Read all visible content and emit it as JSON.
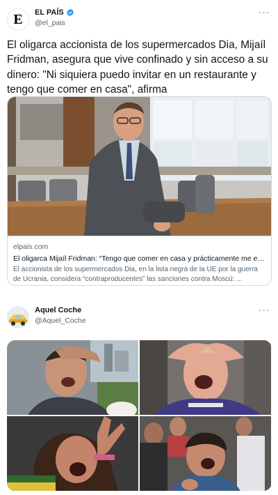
{
  "tweet1": {
    "author_name": "EL PAÍS",
    "author_handle": "@el_pais",
    "avatar_letter": "E",
    "more_label": "···",
    "text": "El oligarca accionista de los supermercados Dia, Mijaíl Fridman, asegura que vive confinado y sin acceso a su dinero: \"Ni siquiera puedo invitar en un restaurante y tengo que comer en casa\", afirma",
    "card": {
      "domain": "elpais.com",
      "title": "El oligarca Mijaíl Fridman: “Tengo que comer en casa y prácticamente me encu...",
      "description": "El accionista de los supermercados Dia, en la lista negra de la UE por la guerra de Ucrania, considera “contraproducentes” las sanciones contra Moscú: ..."
    }
  },
  "tweet2": {
    "author_name": "Aquel Coche",
    "author_handle": "@Aquel_Coche",
    "more_label": "···"
  },
  "colors": {
    "verified": "#1d9bf0",
    "secondary_text": "#536471",
    "border": "#cfd9de"
  }
}
